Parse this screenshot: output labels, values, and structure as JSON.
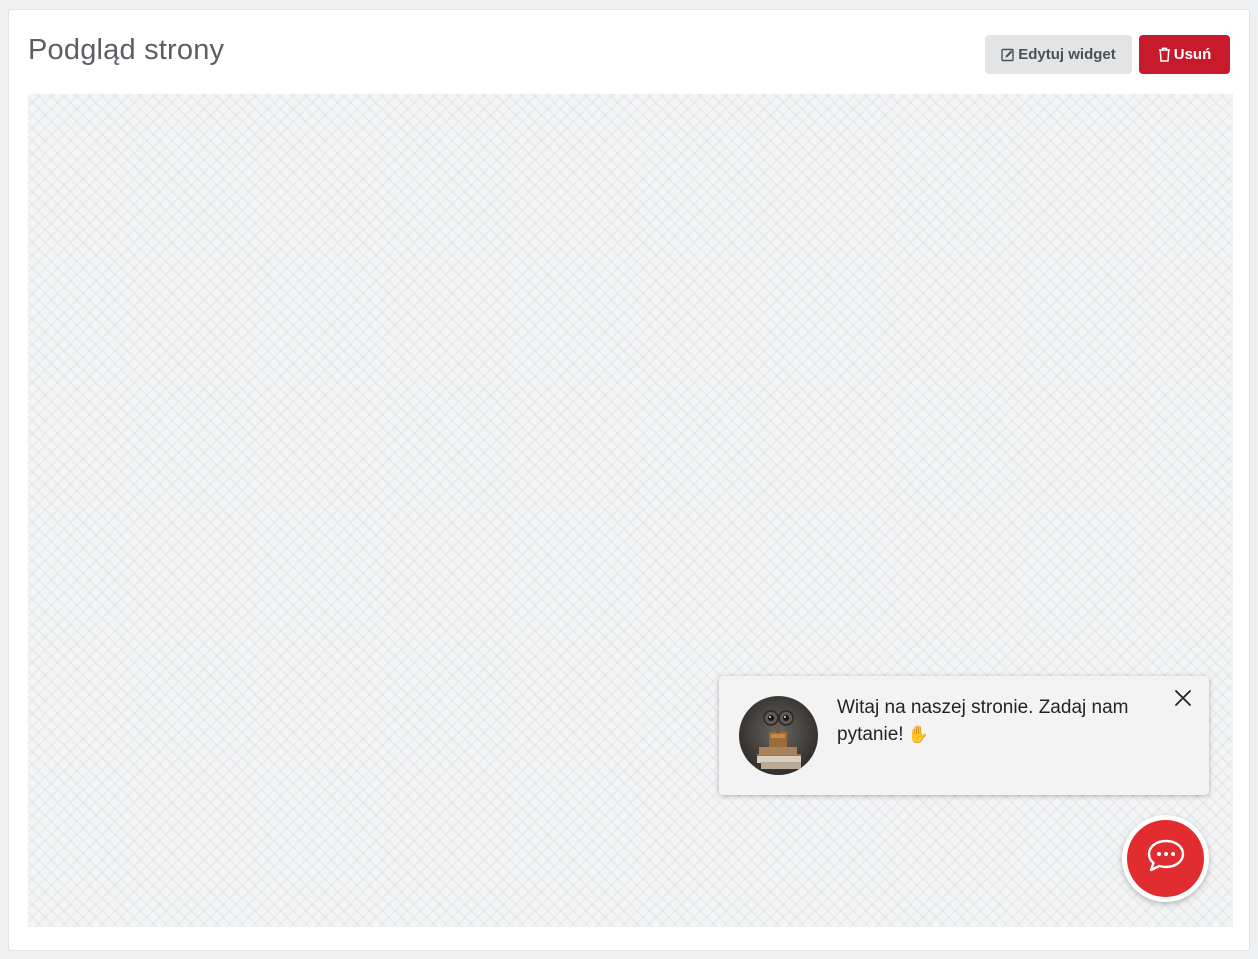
{
  "header": {
    "title": "Podgląd strony"
  },
  "toolbar": {
    "edit_label": "Edytuj widget",
    "edit_icon": "edit-square-icon",
    "delete_label": "Usuń",
    "delete_icon": "trash-icon"
  },
  "colors": {
    "danger": "#c71a2a",
    "chat_accent": "#e12d2f",
    "secondary_button": "#e3e4e5"
  },
  "widget": {
    "message": "Witaj na naszej stronie. Zadaj nam pytanie!",
    "message_emoji": "✋",
    "avatar": "robot-avatar",
    "close_icon": "close-icon",
    "launcher_icon": "chat-bubble-icon"
  }
}
